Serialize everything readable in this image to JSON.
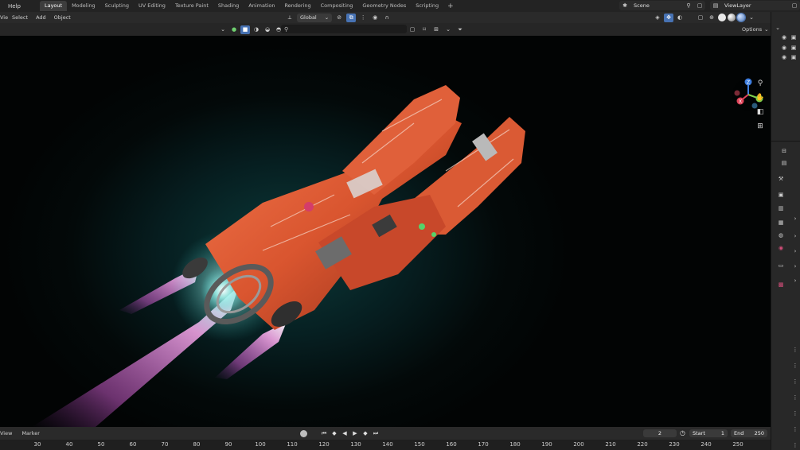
{
  "menubar": {
    "help": "Help",
    "workspaces": [
      "Layout",
      "Modeling",
      "Sculpting",
      "UV Editing",
      "Texture Paint",
      "Shading",
      "Animation",
      "Rendering",
      "Compositing",
      "Geometry Nodes",
      "Scripting"
    ],
    "active_workspace": "Layout",
    "add_workspace": "+",
    "scene": "Scene",
    "view_layer": "ViewLayer"
  },
  "viewport_header": {
    "menus": [
      "View",
      "Select",
      "Add",
      "Object"
    ],
    "transform_orientation": "Global",
    "dropdown_glyph": "v"
  },
  "filter_row": {
    "search_placeholder": "",
    "search_icon": "magnifier-icon",
    "options": "Options"
  },
  "timeline": {
    "menus": [
      "View",
      "Marker"
    ],
    "current_frame": "2",
    "start_label": "Start",
    "start_value": "1",
    "end_label": "End",
    "end_value": "250",
    "ticks": [
      "30",
      "40",
      "50",
      "60",
      "70",
      "80",
      "90",
      "100",
      "110",
      "120",
      "130",
      "140",
      "150",
      "160",
      "170",
      "180",
      "190",
      "200",
      "210",
      "220",
      "230",
      "240",
      "250"
    ]
  },
  "gizmo": {
    "axes": [
      "X",
      "Y",
      "Z"
    ]
  },
  "colors": {
    "accent": "#4772b3",
    "hull": "#d9552f",
    "exhaust": "#e46bd0",
    "glow": "#5fe3e0"
  }
}
